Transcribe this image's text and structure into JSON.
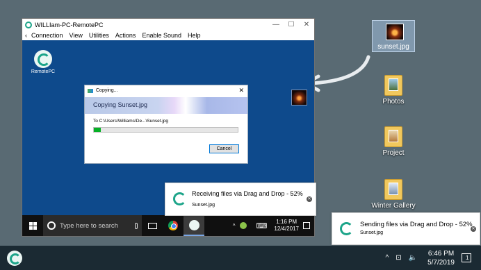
{
  "desktop": {
    "selected_icon": {
      "label": "sunset.jpg"
    },
    "icons": [
      {
        "label": "Photos"
      },
      {
        "label": "Project"
      },
      {
        "label": "Winter Gallery"
      }
    ]
  },
  "remote_window": {
    "title": "WILLIam-PC-RemotePC",
    "controls": {
      "minimize": "—",
      "maximize": "☐",
      "close": "✕"
    },
    "menu": {
      "back": "‹",
      "items": [
        "Connection",
        "View",
        "Utilities",
        "Actions",
        "Enable Sound",
        "Help"
      ]
    },
    "desktop_icon_label": "RemotePC",
    "copy_dialog": {
      "title": "Copying...",
      "banner": "Copying Sunset.jpg",
      "to_line": "To  C:\\Users\\Williams\\De...\\Sunset.jpg",
      "progress_fraction": 0.05,
      "cancel": "Cancel",
      "close": "✕"
    },
    "notification": {
      "title": "Receiving files via Drag and Drop  - 52%",
      "file": "Sunset.jpg",
      "close": "✕"
    },
    "taskbar": {
      "search_placeholder": "Type here to search",
      "tray_up": "^",
      "time": "1:16 PM",
      "date": "12/4/2017",
      "keyboard": "⌨"
    }
  },
  "local_notification": {
    "title": "Sending files via Drag and Drop  - 52%",
    "file": "Sunset.jpg",
    "close": "✕"
  },
  "local_taskbar": {
    "tray_up": "^",
    "network_icon": "⊡",
    "volume_icon": "🔈",
    "time": "6:46 PM",
    "date": "5/7/2019",
    "notification_count": "1"
  },
  "colors": {
    "remote_desktop": "#0e4a8c",
    "accent": "#1ca489",
    "progress": "#06b025"
  }
}
